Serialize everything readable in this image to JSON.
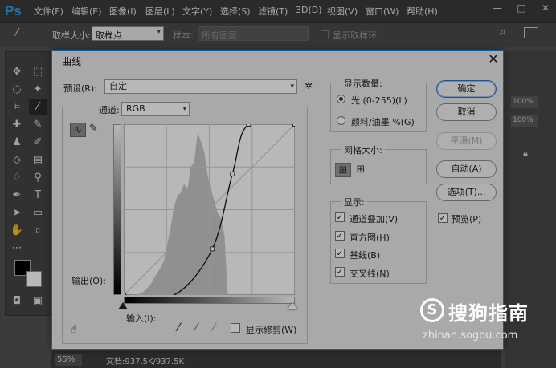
{
  "app": {
    "logo": "Ps"
  },
  "menu": [
    "文件(F)",
    "编辑(E)",
    "图像(I)",
    "图层(L)",
    "文字(Y)",
    "选择(S)",
    "滤镜(T)",
    "3D(D)",
    "视图(V)",
    "窗口(W)",
    "帮助(H)"
  ],
  "window_controls": [
    "—",
    "□",
    "✕"
  ],
  "options": {
    "sample_size_label": "取样大小:",
    "sample_size_value": "取样点",
    "sample_label": "样本:",
    "sample_value": "所有图层",
    "show_ring_label": "显示取样环"
  },
  "status": {
    "zoom": "55%",
    "doc_info": "文档:937.5K/937.5K"
  },
  "right_panel": {
    "opacity1": "100%",
    "opacity2": "100%"
  },
  "dialog": {
    "title": "曲线",
    "preset_label": "预设(R):",
    "preset_value": "自定",
    "channel_label": "通道:",
    "channel_value": "RGB",
    "output_label": "输出(O):",
    "input_label": "输入(I):",
    "show_clipping_label": "显示修剪(W)",
    "buttons": {
      "ok": "确定",
      "cancel": "取消",
      "smooth": "平滑(M)",
      "auto": "自动(A)",
      "options": "选项(T)...",
      "preview": "预览(P)"
    },
    "display_amount": {
      "title": "显示数量:",
      "light": "光 (0-255)(L)",
      "pigment": "颜料/油墨 %(G)",
      "selected": "light"
    },
    "grid_size": {
      "title": "网格大小:"
    },
    "show": {
      "title": "显示:",
      "items": [
        "通道叠加(V)",
        "直方图(H)",
        "基线(B)",
        "交叉线(N)"
      ]
    }
  },
  "watermark": {
    "logo": "S",
    "text": "搜狗指南",
    "url": "zhinan.sogou.com"
  },
  "chart_data": {
    "type": "area",
    "x": [
      0,
      10,
      20,
      25,
      30,
      35,
      40,
      45,
      50,
      55,
      60,
      65,
      70,
      75,
      80,
      85,
      90,
      95,
      100,
      105,
      110,
      115,
      120,
      125,
      130,
      135,
      140,
      145,
      150,
      155,
      160,
      170,
      200,
      255
    ],
    "values": [
      0,
      0,
      0,
      1,
      2,
      4,
      6,
      10,
      13,
      16,
      20,
      30,
      40,
      52,
      58,
      60,
      65,
      62,
      75,
      78,
      95,
      90,
      84,
      70,
      62,
      55,
      48,
      45,
      35,
      0,
      0,
      0,
      0,
      0
    ],
    "curve_points": [
      [
        0,
        0
      ],
      [
        75,
        0
      ],
      [
        132,
        69
      ],
      [
        162,
        181
      ],
      [
        186,
        255
      ],
      [
        255,
        255
      ]
    ],
    "xlim": [
      0,
      255
    ],
    "ylim": [
      0,
      100
    ]
  }
}
